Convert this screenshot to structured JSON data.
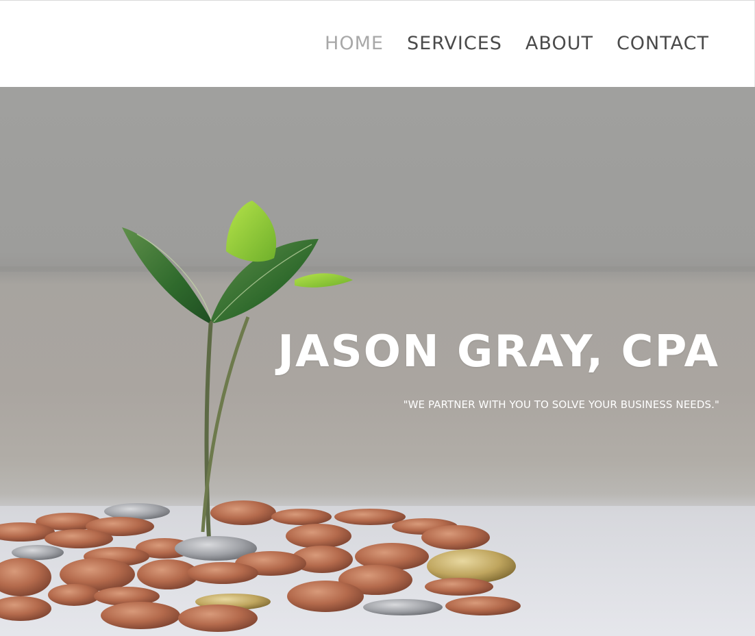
{
  "nav": {
    "items": [
      {
        "label": "HOME",
        "active": true
      },
      {
        "label": "SERVICES",
        "active": false
      },
      {
        "label": "ABOUT",
        "active": false
      },
      {
        "label": "CONTACT",
        "active": false
      }
    ]
  },
  "hero": {
    "title": "JASON GRAY, CPA",
    "tagline": "\"WE PARTNER WITH YOU TO SOLVE YOUR BUSINESS NEEDS.\"",
    "image": "seedling-growing-from-coins-photo"
  },
  "colors": {
    "nav_text": "#4a4a4a",
    "nav_active": "#a8a8a8",
    "hero_text": "#ffffff"
  }
}
